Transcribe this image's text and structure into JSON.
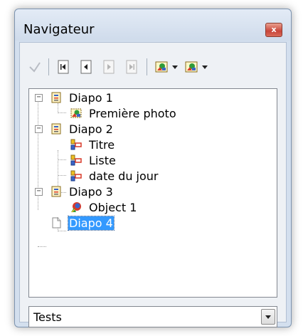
{
  "window": {
    "title": "Navigateur",
    "close_glyph": "x"
  },
  "toolbar": {
    "buttons": [
      {
        "icon": "pointer-icon",
        "enabled": false
      },
      {
        "icon": "first-slide-icon",
        "enabled": true
      },
      {
        "icon": "previous-slide-icon",
        "enabled": true
      },
      {
        "icon": "next-slide-icon",
        "enabled": false
      },
      {
        "icon": "last-slide-icon",
        "enabled": false
      },
      {
        "icon": "drag-mode-icon",
        "enabled": true
      },
      {
        "icon": "show-shapes-icon",
        "enabled": true
      }
    ]
  },
  "tree": {
    "expander_glyph": "−",
    "nodes": [
      {
        "label": "Diapo 1",
        "icon": "slide-icon",
        "children": [
          {
            "label": "Première photo",
            "icon": "image-shape-icon"
          }
        ]
      },
      {
        "label": "Diapo 2",
        "icon": "slide-icon",
        "children": [
          {
            "label": "Titre",
            "icon": "text-shape-icon"
          },
          {
            "label": "Liste",
            "icon": "text-shape-icon"
          },
          {
            "label": "date du jour",
            "icon": "text-shape-icon"
          }
        ]
      },
      {
        "label": "Diapo 3",
        "icon": "slide-icon",
        "children": [
          {
            "label": "Object 1",
            "icon": "ole-object-icon"
          }
        ]
      },
      {
        "label": "Diapo 4",
        "icon": "blank-slide-icon",
        "selected": true
      }
    ]
  },
  "document_select": {
    "value": "Tests"
  },
  "colors": {
    "selection": "#3399ff",
    "window_frame": "#d3dfee",
    "close_button": "#c9453a"
  }
}
